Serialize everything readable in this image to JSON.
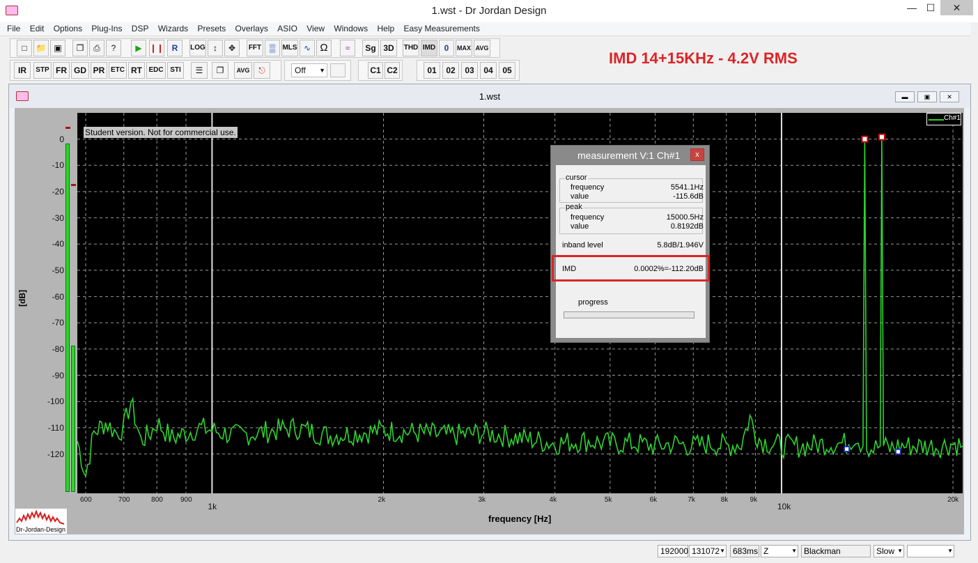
{
  "window": {
    "title": "1.wst - Dr Jordan Design",
    "minimize": "—",
    "maximize": "☐",
    "close": "✕"
  },
  "menu": [
    "File",
    "Edit",
    "Options",
    "Plug-Ins",
    "DSP",
    "Wizards",
    "Presets",
    "Overlays",
    "ASIO",
    "View",
    "Windows",
    "Help",
    "Easy Measurements"
  ],
  "toolbar": {
    "row1": [
      "LOG",
      "FFT",
      "MLS",
      "Sg",
      "3D",
      "THD",
      "IMD",
      "0",
      "MAX",
      "AVG"
    ],
    "row2": [
      "IR",
      "STP",
      "FR",
      "GD",
      "PR",
      "ETC",
      "RT",
      "EDC",
      "STI",
      "AVG"
    ],
    "channels": [
      "C1",
      "C2"
    ],
    "overlays": [
      "01",
      "02",
      "03",
      "04",
      "05"
    ],
    "dropdown_value": "Off",
    "annotation": "IMD 14+15KHz - 4.2V RMS"
  },
  "child": {
    "title": "1.wst"
  },
  "plot": {
    "watermark": "Student version. Not for commercial use.",
    "legend": "Ch#1",
    "ylabel": "[dB]",
    "xlabel": "frequency [Hz]",
    "logo_text": "Dr-Jordan-Design"
  },
  "chart_data": {
    "type": "line",
    "title": "",
    "xlabel": "frequency [Hz]",
    "ylabel": "[dB]",
    "xscale": "log",
    "xlim": [
      580,
      20800
    ],
    "ylim": [
      -135,
      10
    ],
    "yticks": [
      0,
      -10,
      -20,
      -30,
      -40,
      -50,
      -60,
      -70,
      -80,
      -90,
      -100,
      -110,
      -120
    ],
    "xtick_labels": [
      "600",
      "700",
      "800",
      "900",
      "1k",
      "2k",
      "3k",
      "4k",
      "5k",
      "6k",
      "7k",
      "8k",
      "9k",
      "10k",
      "20k"
    ],
    "xtick_values": [
      600,
      700,
      800,
      900,
      1000,
      2000,
      3000,
      4000,
      5000,
      6000,
      7000,
      8000,
      9000,
      10000,
      20000
    ],
    "grid": true,
    "series": [
      {
        "name": "Ch#1",
        "color": "#2fd32f",
        "x": [
          580,
          600,
          620,
          650,
          680,
          700,
          720,
          750,
          780,
          800,
          850,
          900,
          950,
          1000,
          1100,
          1200,
          1400,
          1600,
          1800,
          2000,
          2300,
          2600,
          3000,
          3500,
          4000,
          4500,
          5000,
          5500,
          6000,
          6500,
          7000,
          7500,
          8000,
          8500,
          8800,
          9000,
          9200,
          9600,
          10000,
          11000,
          12000,
          13000,
          13500,
          13900,
          14000,
          14100,
          14500,
          14900,
          15000,
          15100,
          15500,
          16000,
          17000,
          18000,
          19000,
          20000,
          20800
        ],
        "y": [
          -115,
          -128,
          -112,
          -108,
          -112,
          -110,
          -100,
          -115,
          -112,
          -108,
          -114,
          -112,
          -110,
          -111,
          -113,
          -112,
          -110,
          -113,
          -112,
          -111,
          -112,
          -113,
          -112,
          -114,
          -116,
          -115,
          -116,
          -116,
          -117,
          -116,
          -117,
          -116,
          -117,
          -116,
          -106,
          -112,
          -115,
          -116,
          -117,
          -117,
          -116,
          -116,
          -113,
          -117,
          0,
          -117,
          -118,
          -117,
          0.8,
          -117,
          -118,
          -117,
          -117,
          -117,
          -117,
          -116,
          -117
        ]
      }
    ],
    "markers": [
      {
        "type": "peak",
        "x": 14000,
        "y": 0
      },
      {
        "type": "peak",
        "x": 15000,
        "y": 0.8
      },
      {
        "type": "low",
        "x": 13000,
        "y": -118
      },
      {
        "type": "low",
        "x": 16000,
        "y": -119
      }
    ]
  },
  "measurement": {
    "title": "measurement V:1 Ch#1",
    "close": "x",
    "cursor_label": "cursor",
    "cursor_frequency_label": "frequency",
    "cursor_frequency": "5541.1Hz",
    "cursor_value_label": "value",
    "cursor_value": "-115.6dB",
    "peak_label": "peak",
    "peak_frequency_label": "frequency",
    "peak_frequency": "15000.5Hz",
    "peak_value_label": "value",
    "peak_value": "0.8192dB",
    "inband_label": "inband level",
    "inband_value": "5.8dB/1.946V",
    "imd_label": "IMD",
    "imd_value": "0.0002%=-112.20dB",
    "progress_label": "progress",
    "progress_value": 0
  },
  "status": {
    "sample_rate": "192000",
    "fft_size": "131072",
    "time": "683ms",
    "z": "Z",
    "window": "Blackman",
    "speed": "Slow",
    "extra": ""
  }
}
